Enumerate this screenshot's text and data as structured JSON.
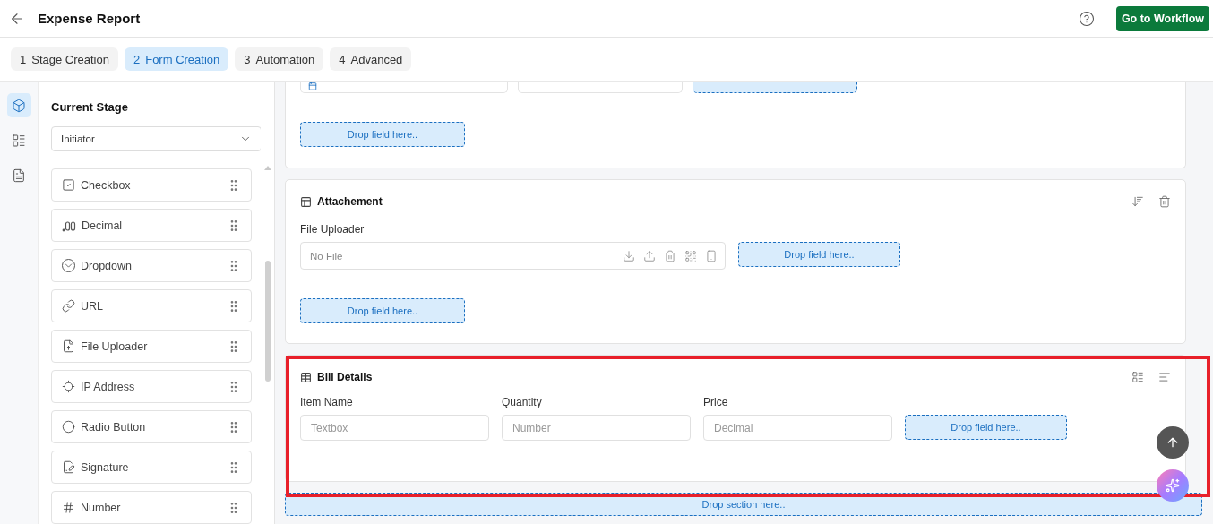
{
  "header": {
    "title": "Expense Report",
    "button": "Go to Workflow"
  },
  "steps": [
    {
      "number": "1",
      "label": "Stage Creation",
      "selected": false
    },
    {
      "number": "2",
      "label": "Form Creation",
      "selected": true
    },
    {
      "number": "3",
      "label": "Automation",
      "selected": false
    },
    {
      "number": "4",
      "label": "Advanced",
      "selected": false
    }
  ],
  "rail": [
    {
      "kind": "components",
      "selected": true
    },
    {
      "kind": "layout",
      "selected": false
    },
    {
      "kind": "rules",
      "selected": false
    }
  ],
  "palette": {
    "title": "Current Stage",
    "stage": "Initiator",
    "items": [
      {
        "kind": "checkbox",
        "label": "Checkbox"
      },
      {
        "kind": "decimal",
        "label": "Decimal"
      },
      {
        "kind": "dropdown",
        "label": "Dropdown"
      },
      {
        "kind": "url",
        "label": "URL"
      },
      {
        "kind": "file",
        "label": "File Uploader"
      },
      {
        "kind": "ip",
        "label": "IP Address"
      },
      {
        "kind": "radio",
        "label": "Radio Button"
      },
      {
        "kind": "signature",
        "label": "Signature"
      },
      {
        "kind": "number",
        "label": "Number"
      }
    ]
  },
  "sections": [
    {
      "kind": "partial",
      "fields": [
        {
          "kind": "date"
        },
        {
          "kind": "input"
        },
        {
          "kind": "drop"
        }
      ],
      "drop": "Drop field here.."
    },
    {
      "kind": "form",
      "title": "Attachement",
      "actions": [
        {
          "kind": "sort"
        },
        {
          "kind": "delete"
        }
      ],
      "fields": [
        {
          "kind": "file",
          "label": "File Uploader",
          "placeholder": "No File"
        },
        {
          "kind": "drop",
          "text": "Drop field here.."
        }
      ],
      "drop": "Drop field here.."
    },
    {
      "kind": "table",
      "title": "Bill Details",
      "highlighted": true,
      "actions": [
        {
          "kind": "layout"
        },
        {
          "kind": "align"
        }
      ],
      "fields": [
        {
          "kind": "input",
          "label": "Item Name",
          "placeholder": "Textbox"
        },
        {
          "kind": "input",
          "label": "Quantity",
          "placeholder": "Number"
        },
        {
          "kind": "input",
          "label": "Price",
          "placeholder": "Decimal"
        },
        {
          "kind": "drop",
          "text": "Drop field here.."
        }
      ]
    }
  ],
  "drop_section": "Drop section here.."
}
